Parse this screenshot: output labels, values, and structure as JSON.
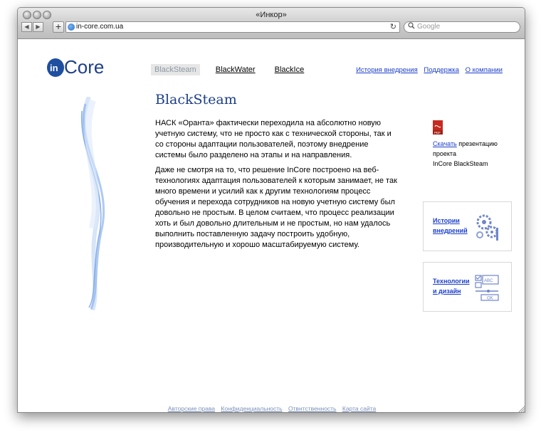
{
  "browser": {
    "window_title": "«Инкор»",
    "url": "in-core.com.ua",
    "search_placeholder": "Google",
    "back_label": "◀",
    "forward_label": "▶",
    "new_tab_label": "+",
    "reload_label": "↻"
  },
  "header": {
    "logo_text": "InCore",
    "tabs": [
      {
        "label": "BlackSteam",
        "active": true
      },
      {
        "label": "BlackWater",
        "active": false
      },
      {
        "label": "BlackIce",
        "active": false
      }
    ],
    "links": [
      "История внедрения",
      "Поддержка",
      "О компании"
    ]
  },
  "main": {
    "title": "BlackSteam",
    "paragraphs": [
      "НАСК «Оранта» фактически переходила на абсолютно новую учетную систему, что не просто как с технической стороны, так и со стороны адаптации пользователей, поэтому внедрение системы было разделено на этапы и на направления.",
      "Даже не смотря на то, что решение InCore построено на веб-технологиях адаптация пользователей к которым занимает, не так много времени и усилий как к другим технологиям процесс обучения и перехода сотрудников на новую учетную систему был довольно не простым. В целом считаем, что процесс реализации хоть и был довольно длительным и не простым, но нам удалось выполнить поставленную задачу построить удобную, производительную и хорошо масштабируемую систему."
    ]
  },
  "sidebar": {
    "download_link": "Скачать",
    "download_text_1": " презентацию",
    "download_text_2": "проекта",
    "download_text_3": "InCore BlackSteam",
    "pdf_badge": "PDF",
    "card1": {
      "line1": "Истории",
      "line2": "внедрений"
    },
    "card2": {
      "line1": "Технологии",
      "line2": "и дизайн",
      "icon_text_abc": "ABC",
      "icon_text_ok": "OK"
    }
  },
  "footer": {
    "links": [
      "Авторские права",
      "Конфиденциальность",
      "Отвнтственность",
      "Карта сайта"
    ]
  },
  "colors": {
    "heading": "#1d3f88",
    "link": "#1c3fc9",
    "footer_link": "#7c8fb8",
    "pdf_red": "#c62a1e",
    "logo_blue": "#1e4fa0"
  }
}
